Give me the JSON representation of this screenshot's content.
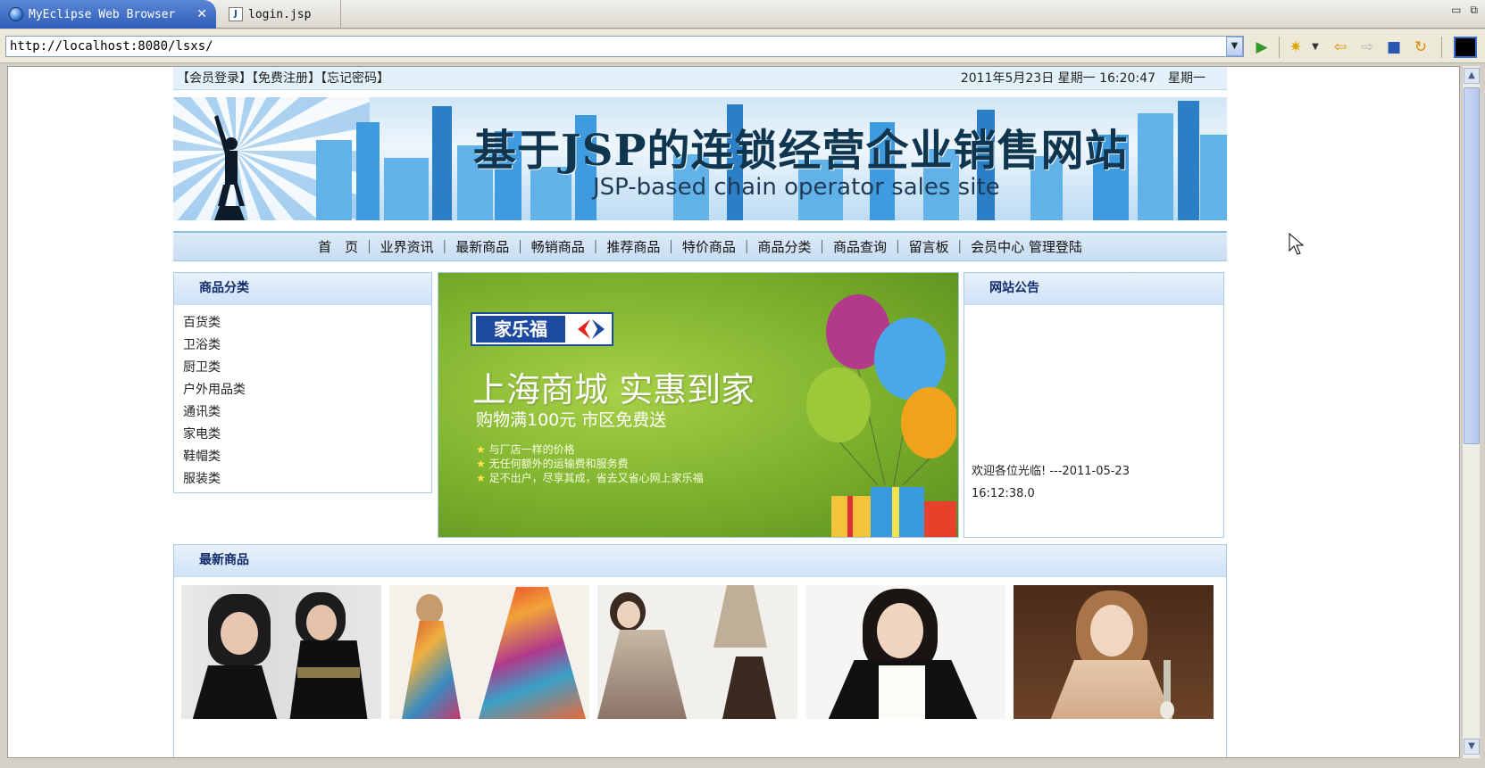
{
  "tabs": [
    {
      "label": "MyEclipse Web Browser",
      "active": true
    },
    {
      "label": "login.jsp",
      "active": false
    }
  ],
  "address": {
    "url": "http://localhost:8080/lsxs/"
  },
  "site": {
    "top_links": "【会员登录】【免费注册】【忘记密码】",
    "datetime": "2011年5月23日 星期一 16:20:47　星期一",
    "banner_title_cn": "基于JSP的连锁经营企业销售网站",
    "banner_title_en": "JSP-based chain operator sales site",
    "nav": [
      "首　页",
      "业界资讯",
      "最新商品",
      "畅销商品",
      "推荐商品",
      "特价商品",
      "商品分类",
      "商品查询",
      "留言板",
      "会员中心",
      "管理登陆"
    ],
    "categories_title": "商品分类",
    "categories": [
      "百货类",
      "卫浴类",
      "厨卫类",
      "户外用品类",
      "通讯类",
      "家电类",
      "鞋帽类",
      "服装类"
    ],
    "ad": {
      "logo_cn": "家乐福",
      "headline": "上海商城 实惠到家",
      "subline": "购物满100元 市区免费送",
      "bullets": [
        "与厂店一样的价格",
        "无任何额外的运输费和服务费",
        "足不出户，尽享其成，省去又省心网上家乐福"
      ]
    },
    "notice_title": "网站公告",
    "notice_text": "欢迎各位光临! ---2011-05-23",
    "notice_time": "16:12:38.0",
    "new_products_title": "最新商品"
  },
  "colors": {
    "accent": "#2f5fb8",
    "nav_bg": "#c7ddf2",
    "panel_border": "#a7cbe9",
    "heading": "#102a6a"
  },
  "icons": [
    "globe-icon",
    "close-icon",
    "jsp-file-icon",
    "minimize-icon",
    "maximize-icon",
    "dropdown-icon",
    "go-icon",
    "bookmark-icon",
    "back-icon",
    "forward-icon",
    "stop-icon",
    "refresh-icon"
  ]
}
